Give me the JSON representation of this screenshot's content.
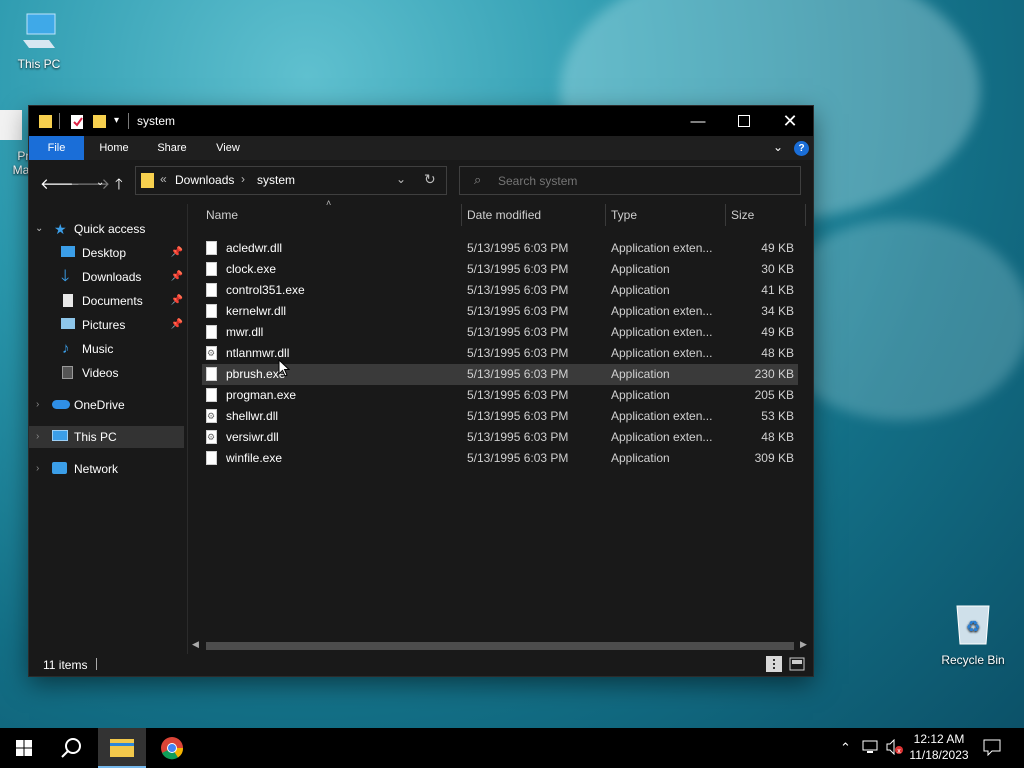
{
  "desktop": {
    "icons": [
      {
        "label": "This PC"
      },
      {
        "label": "Pro\nMan"
      },
      {
        "label": "Recycle Bin"
      }
    ]
  },
  "window": {
    "title": "system",
    "ribbon_tabs": [
      "File",
      "Home",
      "Share",
      "View"
    ],
    "address": {
      "overflow": "«",
      "crumbs": [
        "Downloads",
        "system"
      ]
    },
    "search": {
      "placeholder": "Search system"
    },
    "nav": {
      "quick_access": "Quick access",
      "qa_items": [
        {
          "label": "Desktop",
          "icon": "desktop-icon",
          "pinned": true
        },
        {
          "label": "Downloads",
          "icon": "download-icon",
          "pinned": true
        },
        {
          "label": "Documents",
          "icon": "documents-icon",
          "pinned": true
        },
        {
          "label": "Pictures",
          "icon": "pictures-icon",
          "pinned": true
        },
        {
          "label": "Music",
          "icon": "music-icon",
          "pinned": false
        },
        {
          "label": "Videos",
          "icon": "videos-icon",
          "pinned": false
        }
      ],
      "onedrive": "OneDrive",
      "this_pc": "This PC",
      "network": "Network"
    },
    "columns": [
      "Name",
      "Date modified",
      "Type",
      "Size"
    ],
    "files": [
      {
        "name": "acledwr.dll",
        "date": "5/13/1995 6:03 PM",
        "type": "Application exten...",
        "size": "49 KB",
        "icon": "dll"
      },
      {
        "name": "clock.exe",
        "date": "5/13/1995 6:03 PM",
        "type": "Application",
        "size": "30 KB",
        "icon": "exe"
      },
      {
        "name": "control351.exe",
        "date": "5/13/1995 6:03 PM",
        "type": "Application",
        "size": "41 KB",
        "icon": "exe"
      },
      {
        "name": "kernelwr.dll",
        "date": "5/13/1995 6:03 PM",
        "type": "Application exten...",
        "size": "34 KB",
        "icon": "dll"
      },
      {
        "name": "mwr.dll",
        "date": "5/13/1995 6:03 PM",
        "type": "Application exten...",
        "size": "49 KB",
        "icon": "dll"
      },
      {
        "name": "ntlanmwr.dll",
        "date": "5/13/1995 6:03 PM",
        "type": "Application exten...",
        "size": "48 KB",
        "icon": "dll-gear"
      },
      {
        "name": "pbrush.exe",
        "date": "5/13/1995 6:03 PM",
        "type": "Application",
        "size": "230 KB",
        "icon": "exe"
      },
      {
        "name": "progman.exe",
        "date": "5/13/1995 6:03 PM",
        "type": "Application",
        "size": "205 KB",
        "icon": "exe"
      },
      {
        "name": "shellwr.dll",
        "date": "5/13/1995 6:03 PM",
        "type": "Application exten...",
        "size": "53 KB",
        "icon": "dll-gear"
      },
      {
        "name": "versiwr.dll",
        "date": "5/13/1995 6:03 PM",
        "type": "Application exten...",
        "size": "48 KB",
        "icon": "dll-gear"
      },
      {
        "name": "winfile.exe",
        "date": "5/13/1995 6:03 PM",
        "type": "Application",
        "size": "309 KB",
        "icon": "exe"
      }
    ],
    "hover_row": 6,
    "status": {
      "items": "11 items"
    }
  },
  "taskbar": {
    "time": "12:12 AM",
    "date": "11/18/2023"
  }
}
